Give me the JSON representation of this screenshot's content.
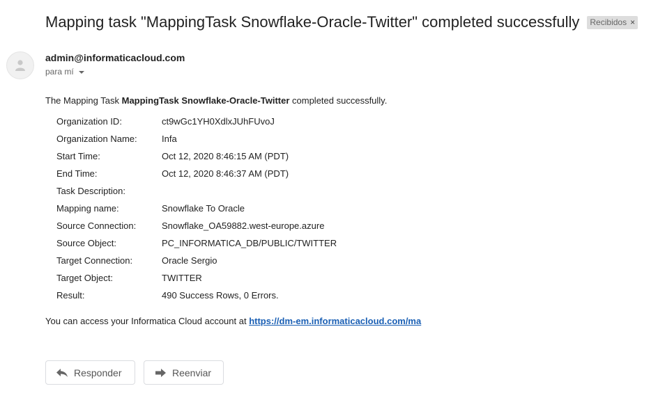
{
  "email": {
    "subject": "Mapping task \"MappingTask Snowflake-Oracle-Twitter\" completed successfully",
    "label": "Recibidos",
    "label_remove": "×",
    "sender": "admin@informaticacloud.com",
    "recipient": "para mí",
    "intro": {
      "prefix": "The Mapping Task ",
      "task_name": "MappingTask Snowflake-Oracle-Twitter",
      "suffix": " completed successfully."
    },
    "details": [
      {
        "label": "Organization ID:",
        "value": "ct9wGc1YH0XdlxJUhFUvoJ"
      },
      {
        "label": "Organization Name:",
        "value": "Infa"
      },
      {
        "label": "Start Time:",
        "value": "Oct 12, 2020 8:46:15 AM (PDT)"
      },
      {
        "label": "End Time:",
        "value": "Oct 12, 2020 8:46:37 AM (PDT)"
      },
      {
        "label": "Task Description:",
        "value": ""
      },
      {
        "label": "Mapping name:",
        "value": "Snowflake To Oracle"
      },
      {
        "label": "Source Connection:",
        "value": "Snowflake_OA59882.west-europe.azure"
      },
      {
        "label": "Source Object:",
        "value": "PC_INFORMATICA_DB/PUBLIC/TWITTER"
      },
      {
        "label": "Target Connection:",
        "value": "Oracle Sergio"
      },
      {
        "label": "Target Object:",
        "value": "TWITTER"
      },
      {
        "label": "Result:",
        "value": "490 Success Rows, 0 Errors."
      }
    ],
    "footer": {
      "text": "You can access your Informatica Cloud account at ",
      "link": "https://dm-em.informaticacloud.com/ma"
    }
  },
  "actions": {
    "reply_label": "Responder",
    "forward_label": "Reenviar"
  },
  "icons": {
    "avatar": "person-icon",
    "reply": "reply-arrow-icon",
    "forward": "forward-arrow-icon",
    "recipient_menu": "caret-down-icon"
  },
  "colors": {
    "link": "#1a5fb4",
    "label_chip_bg": "#dddddd"
  }
}
